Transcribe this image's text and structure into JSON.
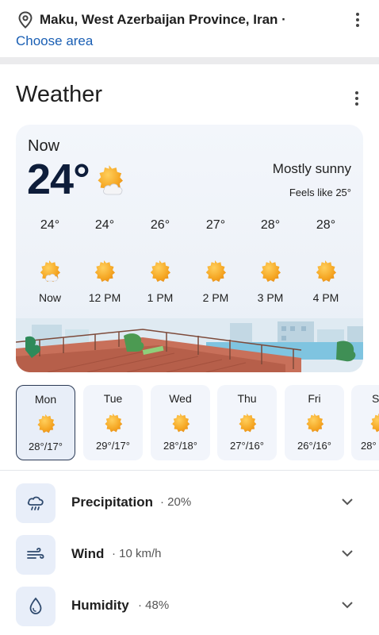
{
  "location": {
    "name": "Maku, West Azerbaijan Province, Iran ·",
    "choose_area": "Choose area"
  },
  "weather": {
    "title": "Weather",
    "now": {
      "label": "Now",
      "temp": "24°",
      "icon": "sun-cloud-icon",
      "condition": "Mostly sunny",
      "feels_like": "Feels like 25°"
    },
    "hourly": [
      {
        "temp": "24°",
        "time": "Now",
        "icon": "sun-cloud-icon"
      },
      {
        "temp": "24°",
        "time": "12 PM",
        "icon": "sun-icon"
      },
      {
        "temp": "26°",
        "time": "1 PM",
        "icon": "sun-icon"
      },
      {
        "temp": "27°",
        "time": "2 PM",
        "icon": "sun-icon"
      },
      {
        "temp": "28°",
        "time": "3 PM",
        "icon": "sun-icon"
      },
      {
        "temp": "28°",
        "time": "4 PM",
        "icon": "sun-icon"
      }
    ],
    "daily": [
      {
        "day": "Mon",
        "range": "28°/17°",
        "selected": true,
        "icon": "sun-icon"
      },
      {
        "day": "Tue",
        "range": "29°/17°",
        "icon": "sun-icon"
      },
      {
        "day": "Wed",
        "range": "28°/18°",
        "icon": "sun-icon"
      },
      {
        "day": "Thu",
        "range": "27°/16°",
        "icon": "sun-icon"
      },
      {
        "day": "Fri",
        "range": "26°/16°",
        "icon": "sun-icon"
      },
      {
        "day": "S",
        "range": "28°",
        "icon": "sun-icon"
      }
    ],
    "metrics": [
      {
        "label": "Precipitation",
        "value": "· 20%",
        "icon": "rain-cloud-icon"
      },
      {
        "label": "Wind",
        "value": "· 10 km/h",
        "icon": "wind-icon"
      },
      {
        "label": "Humidity",
        "value": "· 48%",
        "icon": "water-drop-icon"
      }
    ]
  },
  "colors": {
    "accent_blue": "#1a5fb4",
    "sun_orange": "#f5a623",
    "tile_bg": "#e8eef9",
    "dark_text": "#0e1d3a"
  }
}
